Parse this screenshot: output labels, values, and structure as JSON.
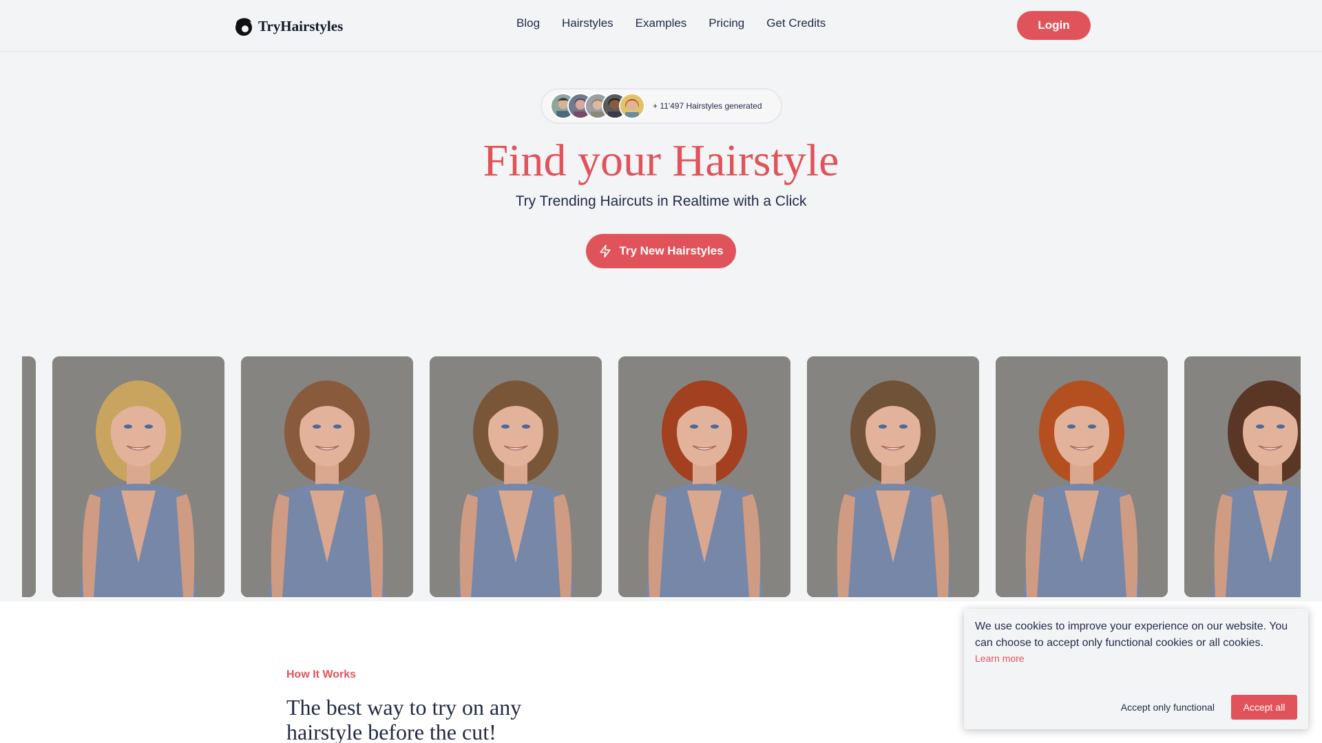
{
  "header": {
    "logo_text": "TryHairstyles",
    "nav": [
      "Blog",
      "Hairstyles",
      "Examples",
      "Pricing",
      "Get Credits"
    ],
    "login_label": "Login"
  },
  "hero": {
    "badge_text": "+ 11'497 Hairstyles generated",
    "title": "Find your Hairstyle",
    "subtitle": "Try Trending Haircuts in Realtime with a Click",
    "cta_label": "Try New Hairstyles"
  },
  "gallery": {
    "images": [
      {
        "name": "hairstyle-image-partial",
        "hair_color": "#7a5a3a"
      },
      {
        "name": "hairstyle-image-blonde-curls",
        "hair_color": "#c9a45e"
      },
      {
        "name": "hairstyle-image-long-straight",
        "hair_color": "#8a5a3c"
      },
      {
        "name": "hairstyle-image-messy-bun",
        "hair_color": "#7a5638"
      },
      {
        "name": "hairstyle-image-red-updo",
        "hair_color": "#a2401f"
      },
      {
        "name": "hairstyle-image-braid",
        "hair_color": "#6f5238"
      },
      {
        "name": "hairstyle-image-copper-bob",
        "hair_color": "#b4501f"
      },
      {
        "name": "hairstyle-image-side-bun",
        "hair_color": "#5a3624"
      }
    ]
  },
  "how_it_works": {
    "label": "How It Works",
    "title": "The best way to try on any hairstyle before the cut!"
  },
  "cookie_banner": {
    "text": "We use cookies to improve your experience on our website. You can choose to accept only functional cookies or all cookies.",
    "learn_more": "Learn more",
    "accept_functional": "Accept only functional",
    "accept_all": "Accept all"
  },
  "colors": {
    "accent": "#e0535a",
    "text": "#1f2a44",
    "background": "#f3f4f6"
  }
}
